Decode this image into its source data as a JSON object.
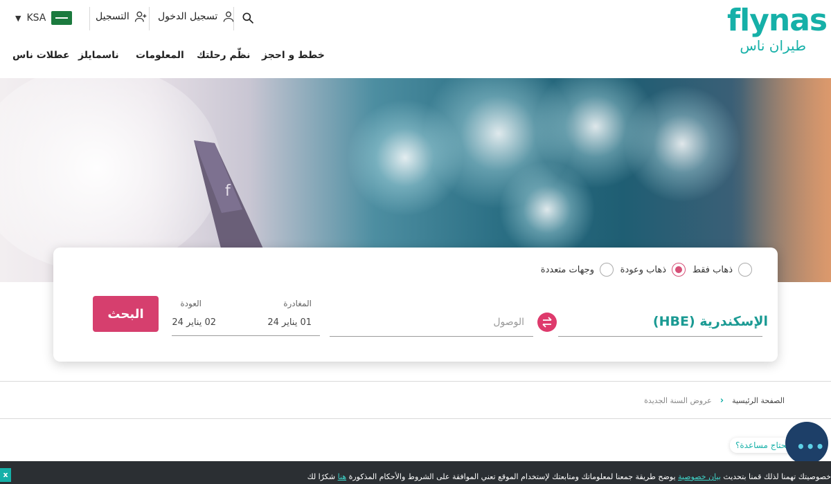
{
  "header": {
    "country_code": "KSA",
    "login_label": "تسجيل الدخول",
    "register_label": "التسجيل",
    "logo_en": "flynas",
    "logo_ar": "طيران ناس"
  },
  "nav": {
    "items": [
      "خطط و احجز",
      "نظّم رحلتك",
      "المعلومات",
      "ناسمايلز",
      "عطلات ناس"
    ]
  },
  "booking": {
    "trip_types": [
      "ذهاب فقط",
      "ذهاب وعودة",
      "وجهات متعددة"
    ],
    "selected_trip_type": "ذهاب وعودة",
    "from_value": "الإسكندرية (HBE)",
    "to_placeholder": "الوصول",
    "departure_label": "المغادرة",
    "departure_value": "01 يناير 24",
    "return_label": "العودة",
    "return_value": "02 يناير 24",
    "search_label": "البحث"
  },
  "breadcrumb": {
    "home": "الصفحة الرئيسية",
    "current": "عروض السنة الجديدة"
  },
  "help": {
    "bubble": "تحتاج مساعدة؟",
    "button": "•••"
  },
  "privacy": {
    "close": "x",
    "text_before": "خصوصيتك تهمنا لذلك قمنا بتحديث",
    "link_privacy": "بيان خصوصية",
    "text_middle": "يوضح طريقة جمعنا لمعلوماتك ومتابعتك لإستخدام الموقع تعني الموافقة على الشروط والأحكام المذكورة",
    "link_here": "هنا",
    "text_after": "شكرًا لك"
  },
  "colors": {
    "brand_teal": "#16b0a8",
    "brand_pink": "#d63f6e",
    "banner_bg": "#2b2f33",
    "help_navy": "#1d3f68"
  }
}
